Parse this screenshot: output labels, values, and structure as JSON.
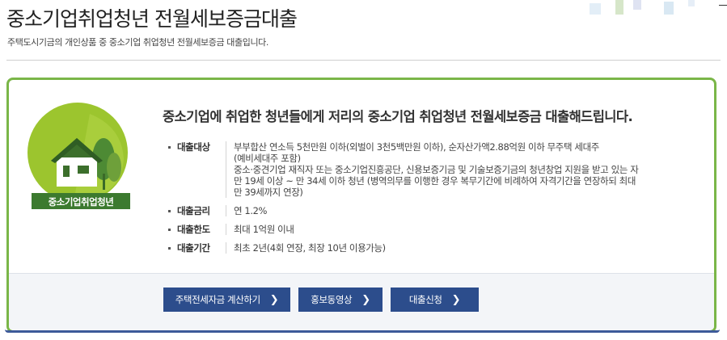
{
  "page": {
    "title": "중소기업취업청년 전월세보증금대출",
    "subtitle": "주택도시기금의 개인상품 중 중소기업 취업청년 전월세보증금 대출입니다."
  },
  "emblem": {
    "label": "중소기업취업청년",
    "icon": "house-trees-icon"
  },
  "headline": "중소기업에 취업한 청년들에게 저리의 중소기업 취업청년 전월세보증금 대출해드립니다.",
  "info": [
    {
      "label": "대출대상",
      "lines": [
        "부부합산 연소득 5천만원 이하(외벌이 3천5백만원 이하), 순자산가액2.88억원 이하 무주택 세대주",
        "(예비세대주 포함)",
        "중소·중견기업 재직자 또는 중소기업진흥공단, 신용보증기금 및 기술보증기금의 청년창업 지원을 받고 있는 자",
        "만 19세 이상 ~ 만 34세 이하 청년 (병역의무를 이행한 경우 복무기간에 비례하여 자격기간을 연장하되 최대",
        "만 39세까지 연장)"
      ]
    },
    {
      "label": "대출금리",
      "lines": [
        "연 1.2%"
      ]
    },
    {
      "label": "대출한도",
      "lines": [
        "최대 1억원 이내"
      ]
    },
    {
      "label": "대출기간",
      "lines": [
        "최초 2년(4회 연장, 최장 10년 이용가능)"
      ]
    }
  ],
  "buttons": [
    {
      "label": "주택전세자금 계산하기",
      "icon": "chevron-right-icon"
    },
    {
      "label": "홍보동영상",
      "icon": "chevron-right-icon"
    },
    {
      "label": "대출신청",
      "icon": "chevron-right-icon"
    }
  ],
  "colors": {
    "accent_green": "#7ab648",
    "button_blue": "#2c4d8c",
    "emblem_green": "#9cc52e",
    "emblem_dark": "#3c7a2f"
  }
}
